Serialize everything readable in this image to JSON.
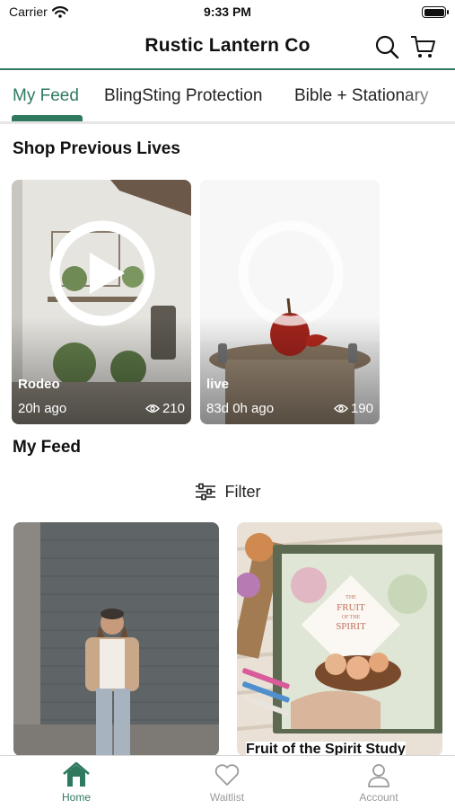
{
  "status": {
    "carrier": "Carrier",
    "time": "9:33 PM"
  },
  "header": {
    "title": "Rustic Lantern Co"
  },
  "tabs": [
    {
      "label": "My Feed",
      "active": true
    },
    {
      "label": "BlingSting Protection"
    },
    {
      "label": "Bible + Stationary"
    }
  ],
  "previous_lives": {
    "title": "Shop Previous Lives",
    "items": [
      {
        "name": "Rodeo",
        "time": "20h ago",
        "views": "210"
      },
      {
        "name": "live",
        "time": "83d 0h ago",
        "views": "190"
      }
    ]
  },
  "feed": {
    "title": "My Feed",
    "filter_label": "Filter",
    "items": [
      {
        "title": ""
      },
      {
        "title": "Fruit of the Spirit Study",
        "book_lines": [
          "THE",
          "FRUIT",
          "OF THE",
          "SPIRIT"
        ]
      }
    ]
  },
  "bottom_nav": [
    {
      "label": "Home",
      "icon": "home-icon",
      "active": true
    },
    {
      "label": "Waitlist",
      "icon": "heart-icon"
    },
    {
      "label": "Account",
      "icon": "person-icon"
    }
  ],
  "colors": {
    "accent": "#2f7a5f",
    "inactive": "#9a9a9a"
  }
}
